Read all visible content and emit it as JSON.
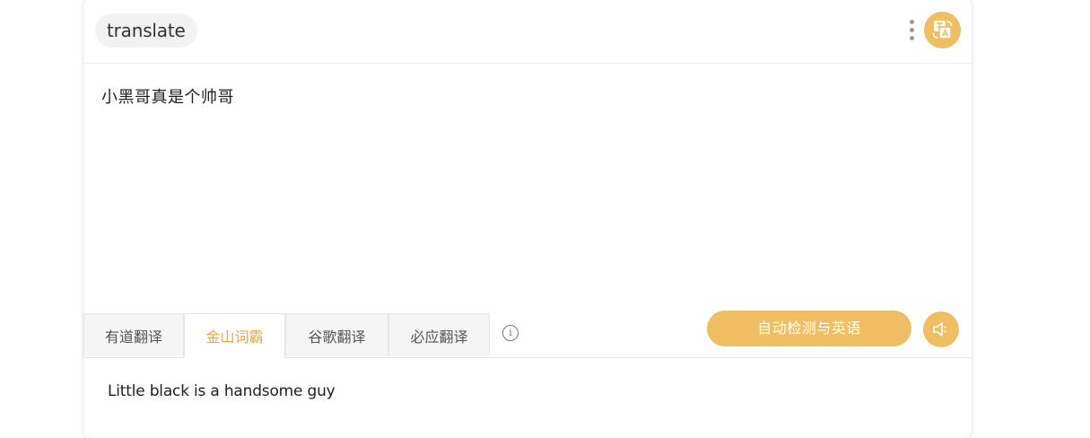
{
  "header": {
    "chip_label": "translate",
    "more_icon": "vertical-ellipsis-icon",
    "logo_icon": "translate-logo-icon",
    "accent_color": "#efbe62"
  },
  "source": {
    "text": "小黑哥真是个帅哥"
  },
  "tabs": [
    {
      "label": "有道翻译",
      "active": false
    },
    {
      "label": "金山词霸",
      "active": true
    },
    {
      "label": "谷歌翻译",
      "active": false
    },
    {
      "label": "必应翻译",
      "active": false
    }
  ],
  "info_icon": "info-icon",
  "language_button": {
    "label": "自动检测与英语"
  },
  "speaker_icon": "speaker-icon",
  "result": {
    "text": "Little black is a handsome guy"
  }
}
